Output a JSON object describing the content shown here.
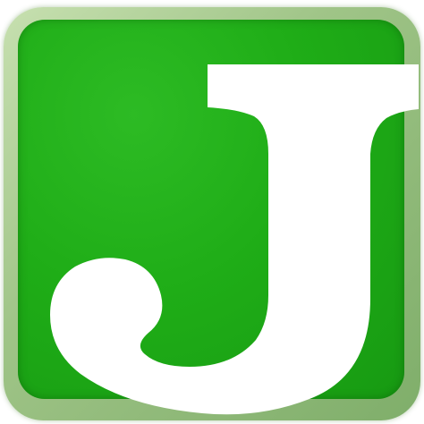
{
  "icon": {
    "glyph": "letter-j",
    "colors": {
      "face": "#1fad17",
      "face_dark": "#179a12",
      "bezel": "#a8cc90",
      "letter": "#ffffff",
      "background": "#ffffff"
    }
  }
}
